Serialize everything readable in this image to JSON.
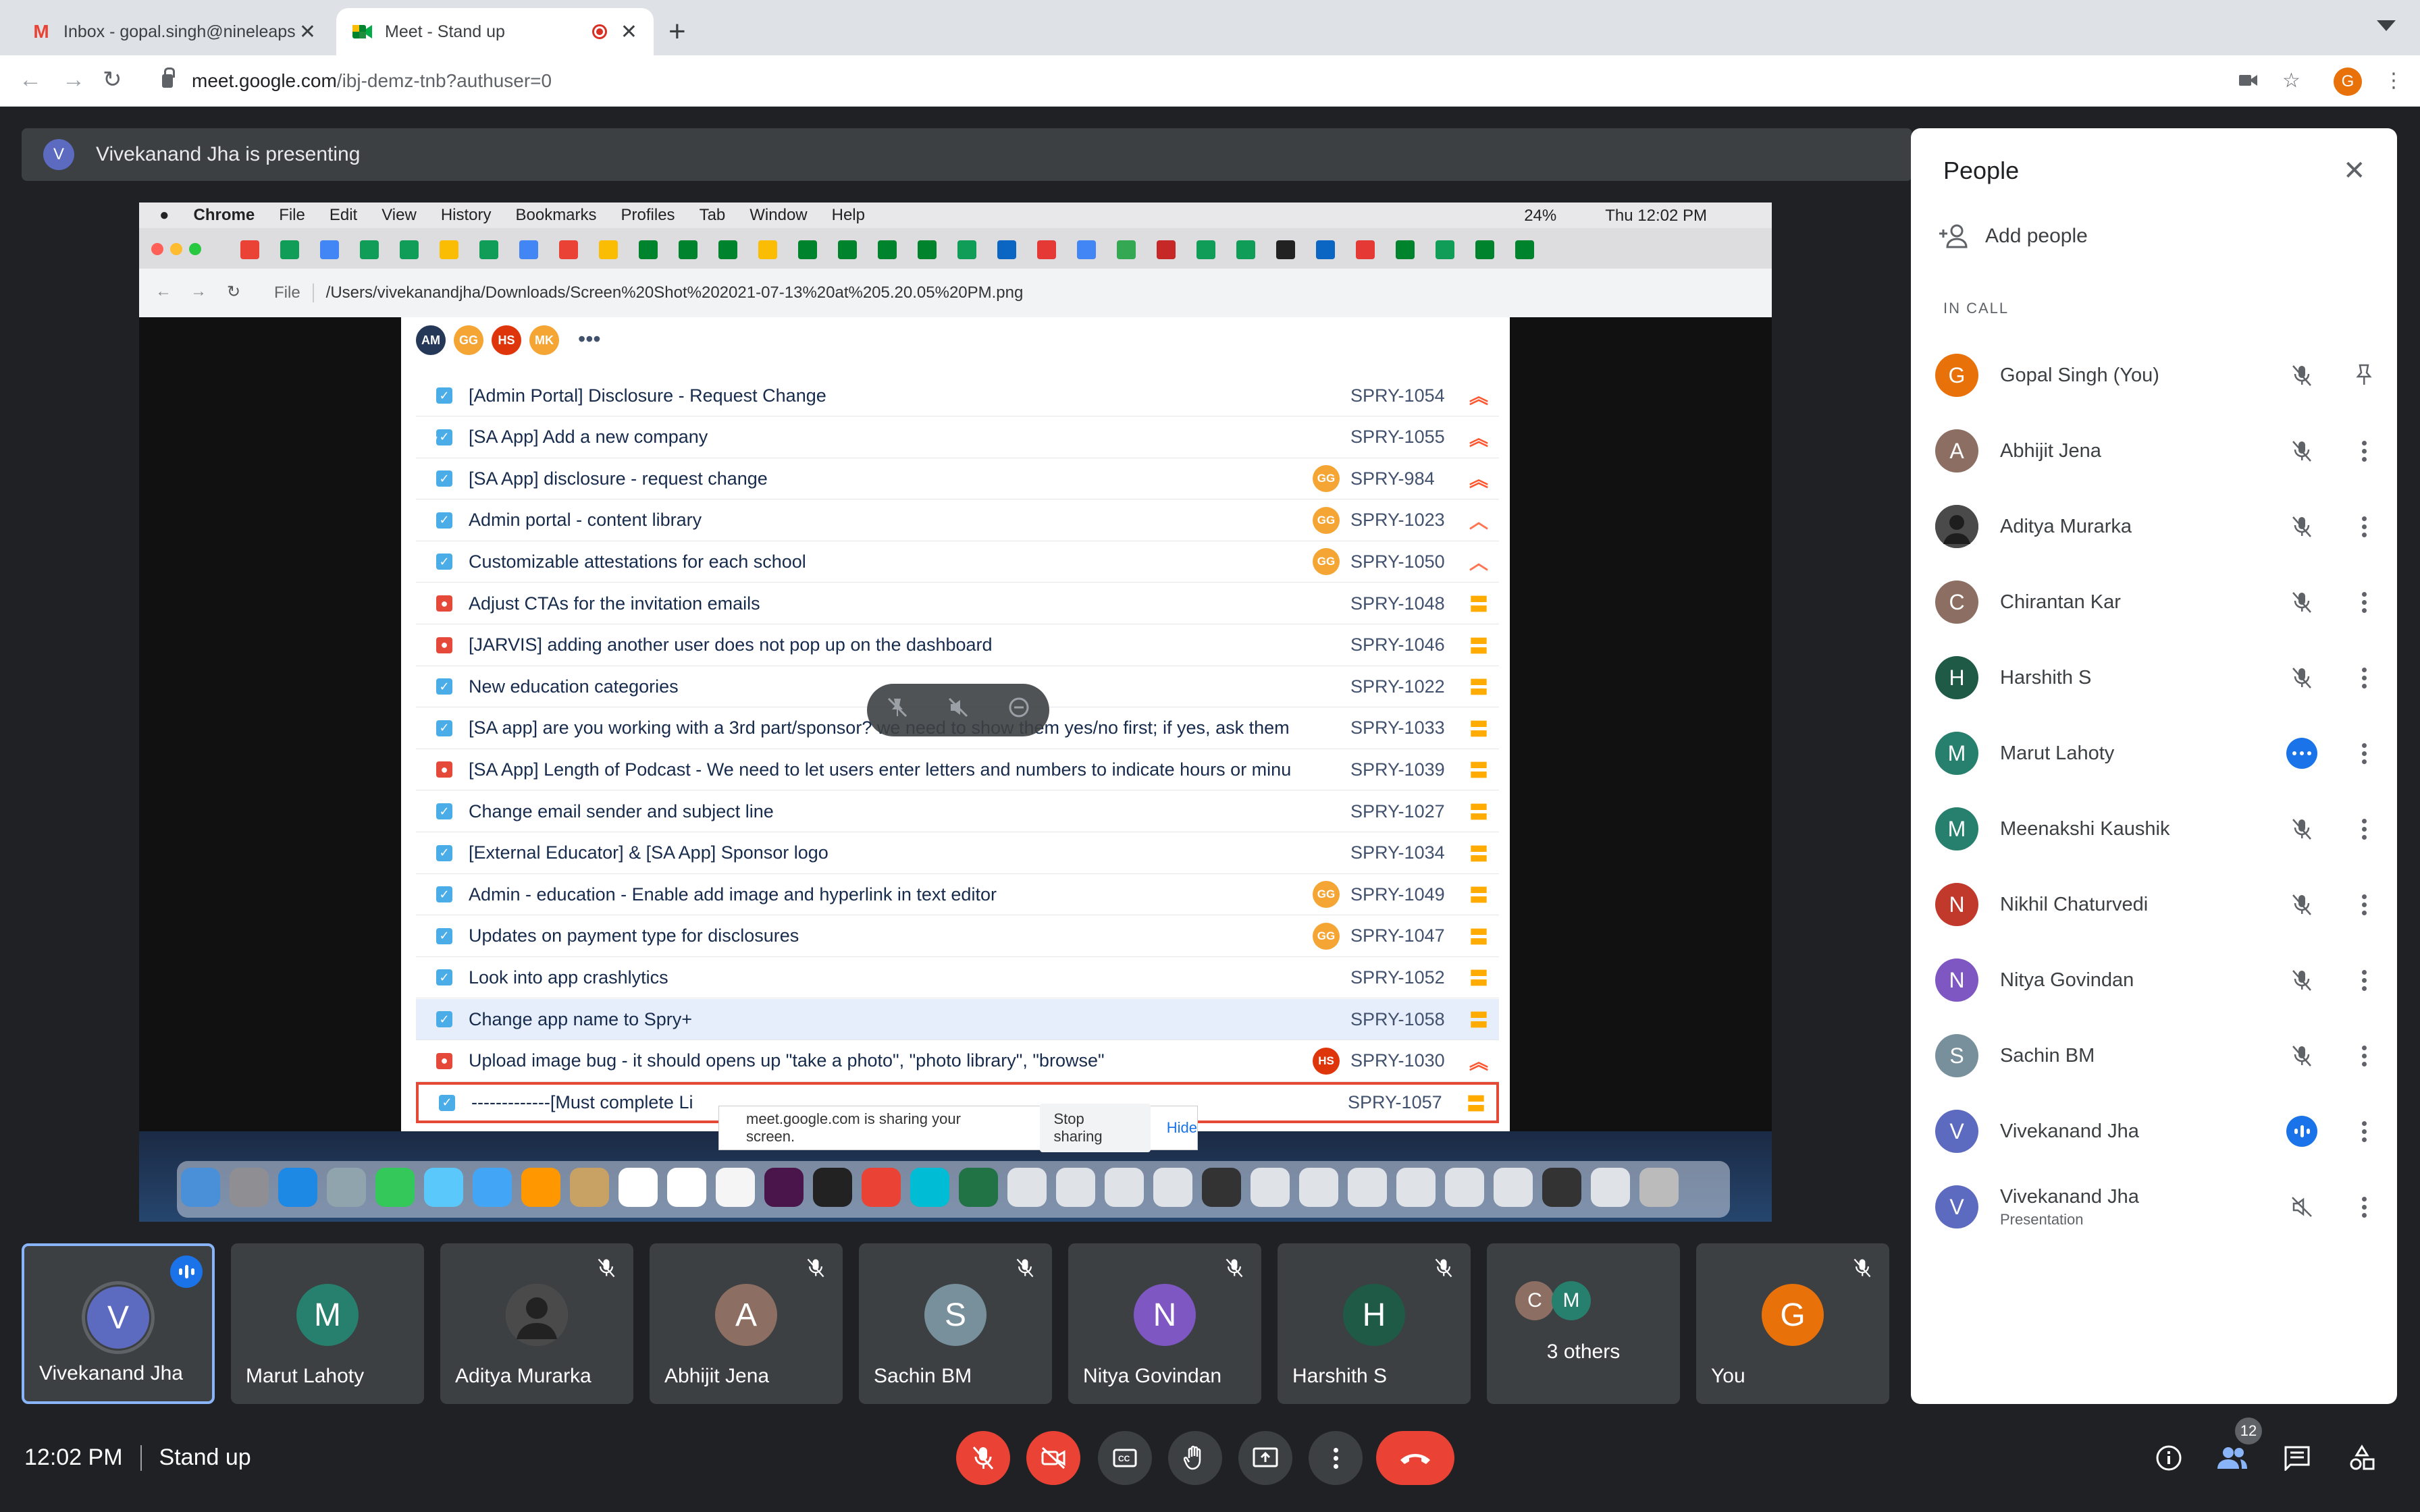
{
  "browser": {
    "tabs": [
      {
        "title": "Inbox - gopal.singh@nineleaps",
        "icon": "gmail-icon"
      },
      {
        "title": "Meet - Stand up",
        "icon": "meet-icon"
      }
    ],
    "url_host": "meet.google.com",
    "url_path": "/ibj-demz-tnb?authuser=0",
    "profile_initial": "G"
  },
  "presenting_banner": {
    "initial": "V",
    "text": "Vivekanand Jha is presenting"
  },
  "shared_screen": {
    "menubar": [
      "Chrome",
      "File",
      "Edit",
      "View",
      "History",
      "Bookmarks",
      "Profiles",
      "Tab",
      "Window",
      "Help"
    ],
    "status": {
      "battery": "24%",
      "clock": "Thu 12:02 PM"
    },
    "address_label": "File",
    "address_path": "/Users/vivekanandjha/Downloads/Screen%20Shot%202021-07-13%20at%205.20.05%20PM.png",
    "header_avatars": [
      {
        "initials": "AM",
        "color": "#253858"
      },
      {
        "initials": "GG",
        "color": "#f4a533"
      },
      {
        "initials": "HS",
        "color": "#de350b"
      },
      {
        "initials": "MK",
        "color": "#f4a533"
      }
    ],
    "issues": [
      {
        "summary": "[Admin Portal] Disclosure - Request Change",
        "key": "SPRY-1054",
        "type": "story",
        "assignee": "",
        "priority": "highest"
      },
      {
        "summary": "[SA App] Add a new company",
        "key": "SPRY-1055",
        "type": "story",
        "assignee": "",
        "priority": "highest"
      },
      {
        "summary": "[SA App] disclosure - request change",
        "key": "SPRY-984",
        "type": "story",
        "assignee": "GG",
        "priority": "highest"
      },
      {
        "summary": "Admin portal - content library",
        "key": "SPRY-1023",
        "type": "story",
        "assignee": "GG",
        "priority": "high"
      },
      {
        "summary": "Customizable attestations for each school",
        "key": "SPRY-1050",
        "type": "story",
        "assignee": "GG",
        "priority": "high"
      },
      {
        "summary": "Adjust CTAs for the invitation emails",
        "key": "SPRY-1048",
        "type": "bug",
        "assignee": "",
        "priority": "medium"
      },
      {
        "summary": "[JARVIS] adding another user does not pop up on the dashboard",
        "key": "SPRY-1046",
        "type": "bug",
        "assignee": "",
        "priority": "medium"
      },
      {
        "summary": "New education categories",
        "key": "SPRY-1022",
        "type": "story",
        "assignee": "",
        "priority": "medium"
      },
      {
        "summary": "[SA app] are you working with a 3rd part/sponsor? we need to show them yes/no first; if yes, ask them",
        "key": "SPRY-1033",
        "type": "story",
        "assignee": "",
        "priority": "medium"
      },
      {
        "summary": "[SA App] Length of Podcast - We need to let users enter letters and numbers to indicate hours or minu",
        "key": "SPRY-1039",
        "type": "bug",
        "assignee": "",
        "priority": "medium"
      },
      {
        "summary": "Change email sender and subject line",
        "key": "SPRY-1027",
        "type": "story",
        "assignee": "",
        "priority": "medium"
      },
      {
        "summary": "[External Educator] & [SA App] Sponsor logo",
        "key": "SPRY-1034",
        "type": "story",
        "assignee": "",
        "priority": "medium"
      },
      {
        "summary": "Admin - education - Enable add image and hyperlink in text editor",
        "key": "SPRY-1049",
        "type": "story",
        "assignee": "GG",
        "priority": "medium"
      },
      {
        "summary": "Updates on payment type for disclosures",
        "key": "SPRY-1047",
        "type": "story",
        "assignee": "GG",
        "priority": "medium"
      },
      {
        "summary": "Look into app crashlytics",
        "key": "SPRY-1052",
        "type": "story",
        "assignee": "",
        "priority": "medium"
      },
      {
        "summary": "Change app name to Spry+",
        "key": "SPRY-1058",
        "type": "story",
        "assignee": "",
        "priority": "medium"
      },
      {
        "summary": "Upload image bug - it should opens up \"take a photo\", \"photo library\", \"browse\"",
        "key": "SPRY-1030",
        "type": "bug",
        "assignee": "HS",
        "priority": "highest"
      },
      {
        "summary": "-------------[Must complete Li",
        "key": "SPRY-1057",
        "type": "story",
        "assignee": "",
        "priority": "medium"
      }
    ],
    "sharing_bar": {
      "text": "meet.google.com is sharing your screen.",
      "stop": "Stop sharing",
      "hide": "Hide"
    }
  },
  "filmstrip": [
    {
      "name": "Vivekanand Jha",
      "initial": "V",
      "color": "#5c6bc0",
      "speaking": true,
      "muted": false
    },
    {
      "name": "Marut Lahoty",
      "initial": "M",
      "color": "#26806d",
      "speaking": false,
      "muted": false
    },
    {
      "name": "Aditya Murarka",
      "initial": "",
      "color": "#6d6d6d",
      "speaking": false,
      "muted": true
    },
    {
      "name": "Abhijit Jena",
      "initial": "A",
      "color": "#8d6e63",
      "speaking": false,
      "muted": true
    },
    {
      "name": "Sachin BM",
      "initial": "S",
      "color": "#78909c",
      "speaking": false,
      "muted": true
    },
    {
      "name": "Nitya Govindan",
      "initial": "N",
      "color": "#7e57c2",
      "speaking": false,
      "muted": true
    },
    {
      "name": "Harshith S",
      "initial": "H",
      "color": "#1e5a45",
      "speaking": false,
      "muted": true
    },
    {
      "name": "3 others",
      "initials": [
        "C",
        "M"
      ],
      "colors": [
        "#8d6e63",
        "#26806d"
      ]
    },
    {
      "name": "You",
      "initial": "G",
      "color": "#e8710a",
      "speaking": false,
      "muted": true
    }
  ],
  "bottom": {
    "time": "12:02 PM",
    "meeting_name": "Stand up",
    "people_count": "12"
  },
  "people_panel": {
    "title": "People",
    "add_people": "Add people",
    "section": "IN CALL",
    "participants": [
      {
        "name": "Gopal Singh (You)",
        "initial": "G",
        "color": "#e8710a",
        "status": "muted",
        "action": "pin"
      },
      {
        "name": "Abhijit Jena",
        "initial": "A",
        "color": "#8d6e63",
        "status": "muted",
        "action": "more"
      },
      {
        "name": "Aditya Murarka",
        "initial": "",
        "color": "#5a5a5a",
        "status": "muted",
        "action": "more"
      },
      {
        "name": "Chirantan Kar",
        "initial": "C",
        "color": "#8d6e63",
        "status": "muted",
        "action": "more"
      },
      {
        "name": "Harshith S",
        "initial": "H",
        "color": "#1e5a45",
        "status": "muted",
        "action": "more"
      },
      {
        "name": "Marut Lahoty",
        "initial": "M",
        "color": "#26806d",
        "status": "idle",
        "action": "more"
      },
      {
        "name": "Meenakshi Kaushik",
        "initial": "M",
        "color": "#26806d",
        "status": "muted",
        "action": "more"
      },
      {
        "name": "Nikhil Chaturvedi",
        "initial": "N",
        "color": "#c0392b",
        "status": "muted",
        "action": "more"
      },
      {
        "name": "Nitya Govindan",
        "initial": "N",
        "color": "#7e57c2",
        "status": "muted",
        "action": "more"
      },
      {
        "name": "Sachin BM",
        "initial": "S",
        "color": "#78909c",
        "status": "muted",
        "action": "more"
      },
      {
        "name": "Vivekanand Jha",
        "initial": "V",
        "color": "#5c6bc0",
        "status": "speaking",
        "action": "more"
      },
      {
        "name": "Vivekanand Jha",
        "initial": "V",
        "color": "#5c6bc0",
        "status": "presentation-muted",
        "action": "more",
        "sub": "Presentation"
      }
    ]
  }
}
